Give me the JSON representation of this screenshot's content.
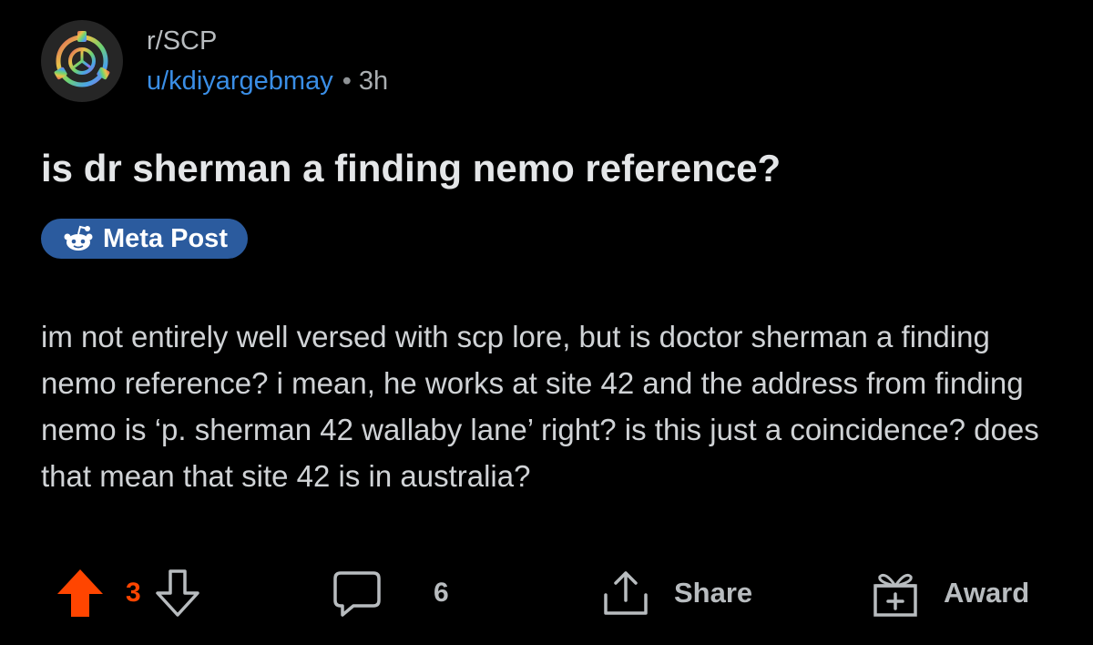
{
  "post": {
    "subreddit": "r/SCP",
    "username": "u/kdiyargebmay",
    "separator": "•",
    "time_ago": "3h",
    "title": "is dr sherman a finding nemo reference?",
    "flair": "Meta Post",
    "body": "im not entirely well versed with scp lore, but is doctor sherman a finding nemo reference? i mean, he works at site 42 and the address from finding nemo is ‘p. sherman 42 wallaby lane’ right? is this just a coincidence? does that mean that site 42 is in australia?"
  },
  "actions": {
    "vote_score": "3",
    "comment_count": "6",
    "share_label": "Share",
    "award_label": "Award"
  },
  "colors": {
    "upvote": "#ff4500",
    "username": "#3a8ee6",
    "flair_bg": "#2b5b9e",
    "background": "#000000"
  },
  "icons": {
    "subreddit_avatar": "scp-logo-icon",
    "flair": "reddit-snoo-icon",
    "upvote": "arrow-up-filled-icon",
    "downvote": "arrow-down-outline-icon",
    "comment": "speech-bubble-icon",
    "share": "share-upload-icon",
    "award": "gift-box-icon"
  }
}
